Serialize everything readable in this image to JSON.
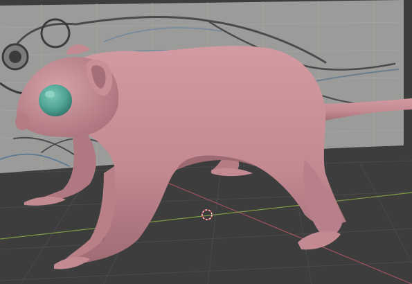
{
  "viewport": {
    "background": "#3d3d3d",
    "grid_color": "#4a4a4a",
    "x_axis_color": "#a0525e",
    "y_axis_color": "#7e9a42",
    "reference_image_color": "#9a9a98"
  },
  "model": {
    "body_color": "#c48a92",
    "body_shadow": "#9e6a72",
    "eye_color": "#4fa394",
    "highlight": "#e2b5ba"
  },
  "cursor": {
    "ring_outer": "#ffffff",
    "ring_inner": "#d04040"
  }
}
